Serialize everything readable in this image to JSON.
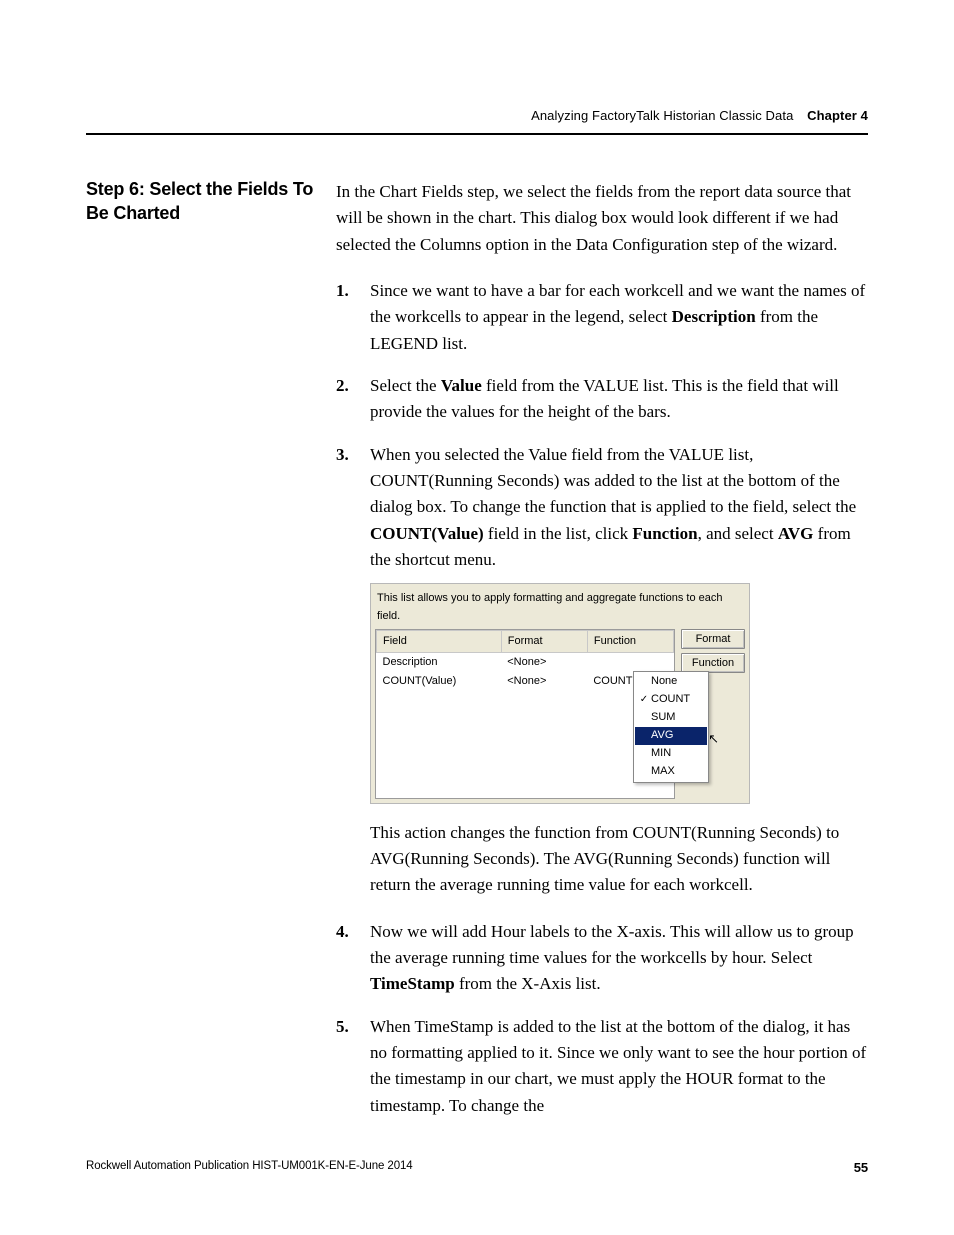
{
  "header": {
    "section_title": "Analyzing FactoryTalk Historian Classic Data",
    "chapter_label": "Chapter 4"
  },
  "sidehead": "Step 6: Select the Fields To Be Charted",
  "intro": "In the Chart Fields step, we select the fields from the report data source that will be shown in the chart. This dialog box would look different if we had selected the Columns option in the Data Configuration step of the wizard.",
  "steps": {
    "s1a": "Since we want to have a bar for each workcell and we want the names of the workcells to appear in the legend, select ",
    "s1b_bold": "Description",
    "s1c": " from the LEGEND list.",
    "s2a": "Select the ",
    "s2b_bold": "Value",
    "s2c": " field from the VALUE list. This is the field that will provide the values for the height of the bars.",
    "s3a": "When you selected the Value field from the VALUE list, COUNT(Running Seconds) was added to the list at the bottom of the dialog box. To change the function that is applied to the field, select the ",
    "s3b_bold": "COUNT(Value)",
    "s3c": " field in the list, click ",
    "s3d_bold": "Function",
    "s3e": ", and select ",
    "s3f_bold": "AVG",
    "s3g": " from the shortcut menu.",
    "s3_after": "This action changes the function from COUNT(Running Seconds) to AVG(Running Seconds). The AVG(Running Seconds) function will return the average running time value for each workcell.",
    "s4a": "Now we will add Hour labels to the X-axis. This will allow us to group the average running time values for the workcells by hour. Select ",
    "s4b_bold": "TimeStamp",
    "s4c": " from the X-Axis list.",
    "s5": "When TimeStamp is added to the list at the bottom of the dialog, it has no formatting applied to it. Since we only want to see the hour portion of the timestamp in our chart, we must apply the HOUR format to the timestamp. To change the"
  },
  "dialog": {
    "caption": "This list allows you to apply formatting and aggregate functions to each field.",
    "cols": {
      "field": "Field",
      "format": "Format",
      "function": "Function"
    },
    "rows": [
      {
        "field": "Description",
        "format": "<None>",
        "function": ""
      },
      {
        "field": "COUNT(Value)",
        "format": "<None>",
        "function": "COUNT"
      }
    ],
    "buttons": {
      "format": "Format",
      "function": "Function"
    },
    "menu": {
      "items": [
        "None",
        "COUNT",
        "SUM",
        "AVG",
        "MIN",
        "MAX"
      ],
      "checked": "COUNT",
      "selected": "AVG"
    }
  },
  "footer": {
    "pub": "Rockwell Automation Publication HIST-UM001K-EN-E-June 2014",
    "page": "55"
  }
}
